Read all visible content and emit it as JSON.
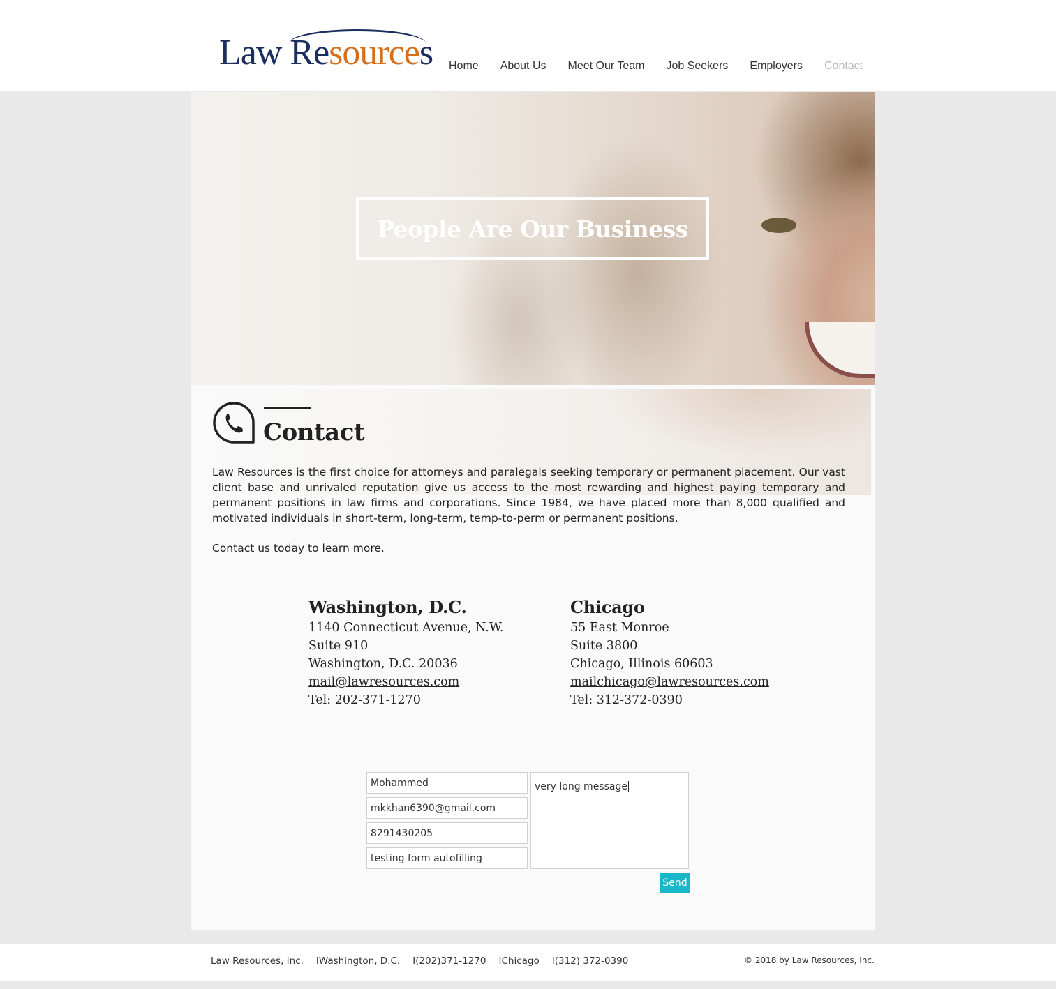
{
  "header": {
    "logo_alt": "Law Resources",
    "nav": [
      {
        "label": "Home"
      },
      {
        "label": "About Us"
      },
      {
        "label": "Meet Our Team"
      },
      {
        "label": "Job Seekers"
      },
      {
        "label": "Employers"
      },
      {
        "label": "Contact"
      }
    ]
  },
  "hero": {
    "headline": "People Are Our Business"
  },
  "contact": {
    "title": "Contact",
    "intro": " Law Resources is the first choice for attorneys and paralegals seeking temporary or permanent placement. Our vast client base and unrivaled reputation give us access to the most rewarding and highest paying temporary and permanent positions in law firms and corporations. Since 1984, we have placed more than 8,000 qualified and motivated individuals in short-term, long-term, temp-to-perm or permanent positions.",
    "cta": "Contact us today to learn more."
  },
  "offices": {
    "dc": {
      "name": "Washington, D.C.",
      "address1": "1140 Connecticut Avenue, N.W.",
      "address2": "Suite 910",
      "city": "Washington, D.C. 20036",
      "email": "mail@lawresources.com",
      "tel": "Tel: 202-371-1270"
    },
    "chicago": {
      "name": "Chicago",
      "address1": "55 East Monroe",
      "address2": "Suite 3800",
      "city": "Chicago, Illinois 60603",
      "email": "mailchicago@lawresources.com",
      "tel": "Tel: 312-372-0390"
    }
  },
  "form": {
    "name": "Mohammed",
    "email": "mkkhan6390@gmail.com",
    "phone": "8291430205",
    "subject": "testing form autofilling",
    "message": "very long message",
    "send_label": "Send"
  },
  "footer": {
    "company": "Law Resources, Inc.",
    "sep": "I",
    "city1": "Washington, D.C.",
    "phone1": "(202)371-1270",
    "city2": "Chicago",
    "phone2": "(312) 372-0390",
    "copyright": "© 2018 by Law Resources, Inc."
  },
  "colors": {
    "brand_navy": "#1b2f5e",
    "brand_orange": "#d4701d",
    "send_button": "#1ab7c8"
  }
}
